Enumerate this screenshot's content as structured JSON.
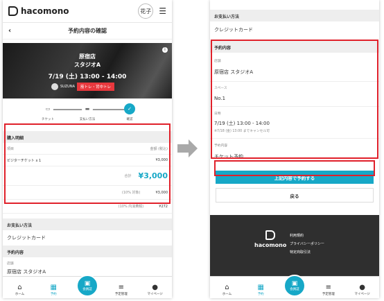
{
  "brand": "hacomono",
  "left": {
    "avatar": "花子",
    "page_title": "予約内容の確認",
    "hero": {
      "store": "原宿店",
      "studio": "スタジオA",
      "datetime": "7/19 (土) 13:00 - 14:00",
      "instructor": "SUZUNA",
      "tag": "筋トレ・背中トレ"
    },
    "steps": [
      {
        "label": "チケット"
      },
      {
        "label": "支払い方法"
      },
      {
        "label": "確認"
      }
    ],
    "purchase": {
      "section": "購入明細",
      "col_item": "項目",
      "col_amount": "金額 (税込)",
      "item": "ビジターチケット x 1",
      "item_price": "¥3,000",
      "total_label": "合計",
      "total": "¥3,000",
      "tax_target_label": "(10% 対象)",
      "tax_target": "¥3,000",
      "tax_label": "(10% 内消費税)",
      "tax": "¥272"
    },
    "payment_section": "お支払い方法",
    "payment_value": "クレジットカード",
    "booking_section": "予約内容",
    "store_label": "店舗",
    "store_value": "原宿店 スタジオA"
  },
  "right": {
    "payment_section": "お支払い方法",
    "payment_value": "クレジットカード",
    "booking_section": "予約内容",
    "fields": [
      {
        "label": "店舗",
        "value": "原宿店 スタジオA"
      },
      {
        "label": "スペース",
        "value": "No.1"
      },
      {
        "label": "日時",
        "value": "7/19 (土) 13:00 - 14:00",
        "note": "※7/18 (金) 13:00 までキャンセル可"
      },
      {
        "label": "予約内容",
        "value": "チケット予約"
      }
    ],
    "confirm_button": "上記内容で予約する",
    "back_button": "戻る",
    "footer_links": [
      "利用規約",
      "プライバシーポリシー",
      "特定商取引法"
    ]
  },
  "nav": [
    {
      "label": "ホーム",
      "icon": "home-icon"
    },
    {
      "label": "予約",
      "icon": "calendar-icon"
    },
    {
      "label": "会員証",
      "icon": "qr-icon"
    },
    {
      "label": "予定管理",
      "icon": "list-icon"
    },
    {
      "label": "マイページ",
      "icon": "user-icon"
    }
  ],
  "colors": {
    "accent": "#17a8c7",
    "highlight": "#e0202a",
    "tag": "#e8383d"
  }
}
